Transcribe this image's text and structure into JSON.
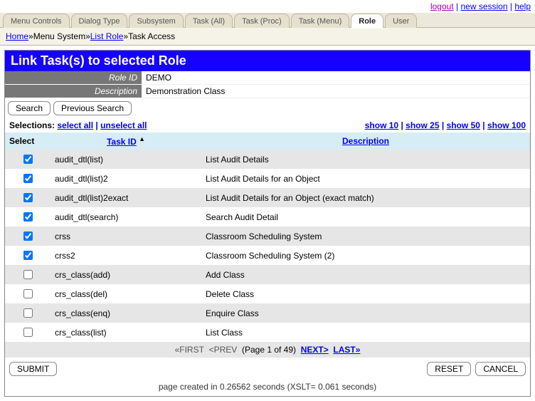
{
  "topLinks": {
    "logout": "logout",
    "new_session": "new session",
    "help": "help"
  },
  "tabs": [
    {
      "label": "Menu Controls",
      "active": false
    },
    {
      "label": "Dialog Type",
      "active": false
    },
    {
      "label": "Subsystem",
      "active": false
    },
    {
      "label": "Task (All)",
      "active": false
    },
    {
      "label": "Task (Proc)",
      "active": false
    },
    {
      "label": "Task (Menu)",
      "active": false
    },
    {
      "label": "Role",
      "active": true
    },
    {
      "label": "User",
      "active": false
    }
  ],
  "breadcrumb": {
    "home": "Home",
    "seg1": "Menu System",
    "seg2": "List Role",
    "seg3": "Task Access"
  },
  "title": "Link Task(s) to selected Role",
  "meta": {
    "roleIdLabel": "Role ID",
    "roleIdValue": "DEMO",
    "descriptionLabel": "Description",
    "descriptionValue": "Demonstration Class"
  },
  "buttons": {
    "search": "Search",
    "previous": "Previous Search",
    "submit": "SUBMIT",
    "reset": "RESET",
    "cancel": "CANCEL"
  },
  "selectionBar": {
    "label": "Selections:",
    "selectAll": "select all",
    "unselectAll": "unselect all",
    "show10": "show 10",
    "show25": "show 25",
    "show50": "show 50",
    "show100": "show 100"
  },
  "columns": {
    "select": "Select",
    "taskId": "Task ID",
    "description": "Description"
  },
  "rows": [
    {
      "checked": true,
      "task": "audit_dtl(list)",
      "desc": "List Audit Details"
    },
    {
      "checked": true,
      "task": "audit_dtl(list)2",
      "desc": "List Audit Details for an Object"
    },
    {
      "checked": true,
      "task": "audit_dtl(list)2exact",
      "desc": "List Audit Details for an Object (exact match)"
    },
    {
      "checked": true,
      "task": "audit_dtl(search)",
      "desc": "Search Audit Detail"
    },
    {
      "checked": true,
      "task": "crss",
      "desc": "Classroom Scheduling System"
    },
    {
      "checked": true,
      "task": "crss2",
      "desc": "Classroom Scheduling System (2)"
    },
    {
      "checked": false,
      "task": "crs_class(add)",
      "desc": "Add Class"
    },
    {
      "checked": false,
      "task": "crs_class(del)",
      "desc": "Delete Class"
    },
    {
      "checked": false,
      "task": "crs_class(enq)",
      "desc": "Enquire Class"
    },
    {
      "checked": false,
      "task": "crs_class(list)",
      "desc": "List Class"
    }
  ],
  "pager": {
    "first": "«FIRST",
    "prev": "<PREV",
    "page": "(Page 1 of 49)",
    "next": "NEXT>",
    "last": "LAST»"
  },
  "stats": "page created in 0.26562 seconds (XSLT= 0.061 seconds)"
}
